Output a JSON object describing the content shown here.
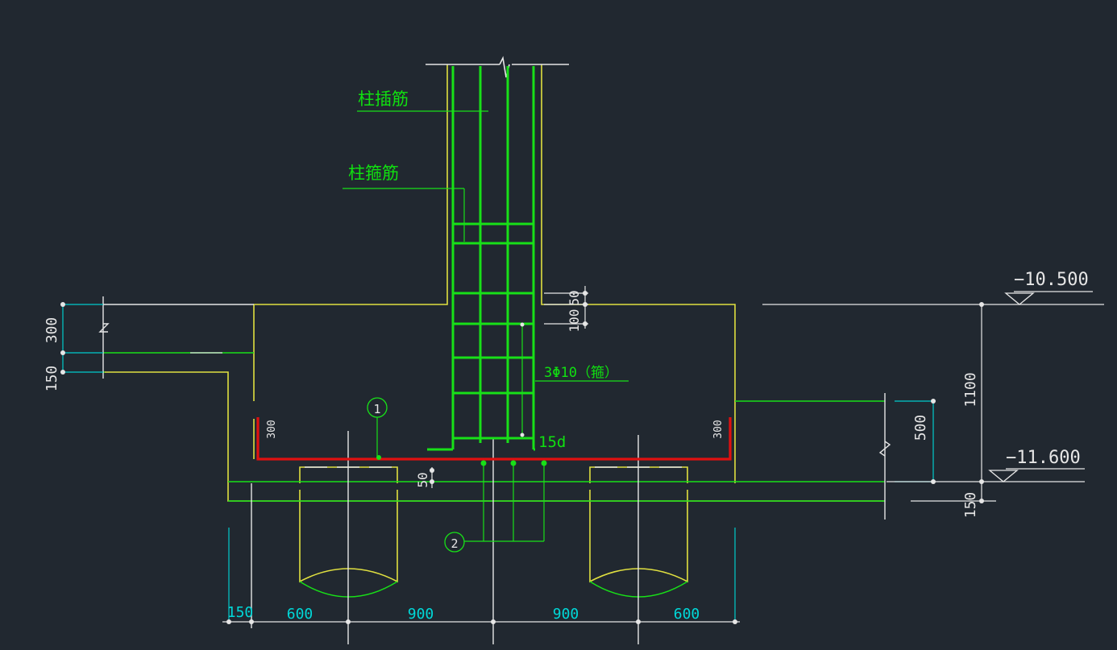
{
  "colors": {
    "background": "#212830",
    "outline": "#e0e040",
    "rebar": "#18e018",
    "bottom_rebar": "#e01010",
    "dimension": "#00cccc",
    "text_white": "#e6e6e6",
    "text_green": "#10e010",
    "text_cyan": "#00d8d8"
  },
  "labels": {
    "column_dowel": "柱插筋",
    "column_stirrup": "柱箍筋",
    "stirrup_spec": "3Φ10（箍）",
    "anchor_15d": "15d",
    "callout_1": "1",
    "callout_2": "2"
  },
  "elevations": {
    "top": "−10.500",
    "bottom": "−11.600"
  },
  "dimensions": {
    "left_300": "300",
    "left_150": "150",
    "bend_left": "300",
    "bend_right": "300",
    "col_50": "50",
    "col_100": "100",
    "cover_50": "50",
    "right_500": "500",
    "right_1100": "1100",
    "right_150": "150",
    "bottom_150": "150",
    "bottom_600_left": "600",
    "bottom_900_left": "900",
    "bottom_900_right": "900",
    "bottom_600_right": "600"
  }
}
